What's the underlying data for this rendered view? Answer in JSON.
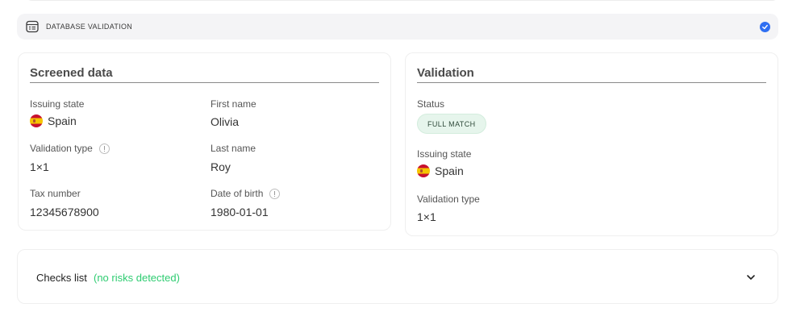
{
  "header": {
    "title": "DATABASE VALIDATION",
    "icon": "database-table-icon",
    "status_icon": "check-circle-icon",
    "accent": "#2f6ff2"
  },
  "screened": {
    "title": "Screened data",
    "fields": {
      "issuing_state_label": "Issuing state",
      "issuing_state_value": "Spain",
      "first_name_label": "First name",
      "first_name_value": "Olivia",
      "validation_type_label": "Validation type",
      "validation_type_value": "1×1",
      "last_name_label": "Last name",
      "last_name_value": "Roy",
      "tax_number_label": "Tax number",
      "tax_number_value": "12345678900",
      "dob_label": "Date of birth",
      "dob_value": "1980-01-01"
    }
  },
  "validation": {
    "title": "Validation",
    "status_label": "Status",
    "status_value": "FULL MATCH",
    "status_color": "#e6f5ec",
    "issuing_state_label": "Issuing state",
    "issuing_state_value": "Spain",
    "validation_type_label": "Validation type",
    "validation_type_value": "1×1"
  },
  "checks": {
    "label": "Checks list",
    "note": "(no risks detected)",
    "note_color": "#2ecc71"
  }
}
